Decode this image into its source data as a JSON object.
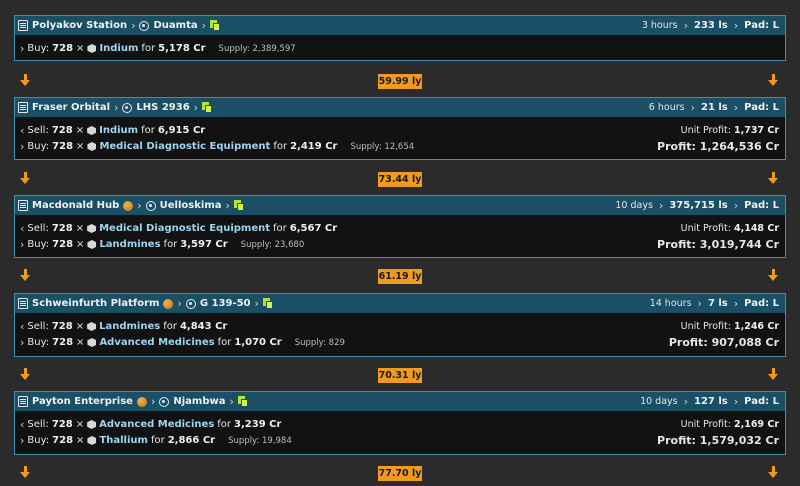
{
  "legs": [
    {
      "station": "Polyakov Station",
      "system": "Duamta",
      "planetary": false,
      "age": "3 hours",
      "distance_ls": "233 ls",
      "pad": "Pad: L",
      "buy": {
        "prefix": "Buy:",
        "qty": "728",
        "times": "×",
        "commodity": "Indium",
        "for": "for",
        "price": "5,178 Cr",
        "supply": "Supply: 2,389,597"
      }
    },
    {
      "station": "Fraser Orbital",
      "system": "LHS 2936",
      "planetary": false,
      "age": "6 hours",
      "distance_ls": "21 ls",
      "pad": "Pad: L",
      "sell": {
        "prefix": "Sell:",
        "qty": "728",
        "times": "×",
        "commodity": "Indium",
        "for": "for",
        "price": "6,915 Cr"
      },
      "buy": {
        "prefix": "Buy:",
        "qty": "728",
        "times": "×",
        "commodity": "Medical Diagnostic Equipment",
        "for": "for",
        "price": "2,419 Cr",
        "supply": "Supply: 12,654"
      },
      "unit_profit_label": "Unit Profit:",
      "unit_profit": "1,737 Cr",
      "profit_label": "Profit:",
      "profit": "1,264,536 Cr"
    },
    {
      "station": "Macdonald Hub",
      "system": "Uelloskima",
      "planetary": true,
      "age": "10 days",
      "distance_ls": "375,715 ls",
      "pad": "Pad: L",
      "sell": {
        "prefix": "Sell:",
        "qty": "728",
        "times": "×",
        "commodity": "Medical Diagnostic Equipment",
        "for": "for",
        "price": "6,567 Cr"
      },
      "buy": {
        "prefix": "Buy:",
        "qty": "728",
        "times": "×",
        "commodity": "Landmines",
        "for": "for",
        "price": "3,597 Cr",
        "supply": "Supply: 23,680"
      },
      "unit_profit_label": "Unit Profit:",
      "unit_profit": "4,148 Cr",
      "profit_label": "Profit:",
      "profit": "3,019,744 Cr"
    },
    {
      "station": "Schweinfurth Platform",
      "system": "G 139-50",
      "planetary": true,
      "age": "14 hours",
      "distance_ls": "7 ls",
      "pad": "Pad: L",
      "sell": {
        "prefix": "Sell:",
        "qty": "728",
        "times": "×",
        "commodity": "Landmines",
        "for": "for",
        "price": "4,843 Cr"
      },
      "buy": {
        "prefix": "Buy:",
        "qty": "728",
        "times": "×",
        "commodity": "Advanced Medicines",
        "for": "for",
        "price": "1,070 Cr",
        "supply": "Supply: 829"
      },
      "unit_profit_label": "Unit Profit:",
      "unit_profit": "1,246 Cr",
      "profit_label": "Profit:",
      "profit": "907,088 Cr"
    },
    {
      "station": "Payton Enterprise",
      "system": "Njambwa",
      "planetary": true,
      "age": "10 days",
      "distance_ls": "127 ls",
      "pad": "Pad: L",
      "sell": {
        "prefix": "Sell:",
        "qty": "728",
        "times": "×",
        "commodity": "Advanced Medicines",
        "for": "for",
        "price": "3,239 Cr"
      },
      "buy": {
        "prefix": "Buy:",
        "qty": "728",
        "times": "×",
        "commodity": "Thallium",
        "for": "for",
        "price": "2,866 Cr",
        "supply": "Supply: 19,984"
      },
      "unit_profit_label": "Unit Profit:",
      "unit_profit": "2,169 Cr",
      "profit_label": "Profit:",
      "profit": "1,579,032 Cr"
    }
  ],
  "jumps": [
    "59.99 ly",
    "73.44 ly",
    "61.19 ly",
    "70.31 ly",
    "77.70 ly"
  ],
  "colors": {
    "header_bg": "#1b4f66",
    "border": "#3f8fb0",
    "accent": "#f09a1f",
    "commodity_link": "#9fd3ef",
    "copy_icon": "#b4e32b"
  },
  "icons": {
    "station": "station-icon",
    "system": "system-target-icon",
    "copy": "copy-icon",
    "planetary": "planet-icon",
    "commodity": "cargo-box-icon",
    "jump": "arrow-down-icon"
  }
}
